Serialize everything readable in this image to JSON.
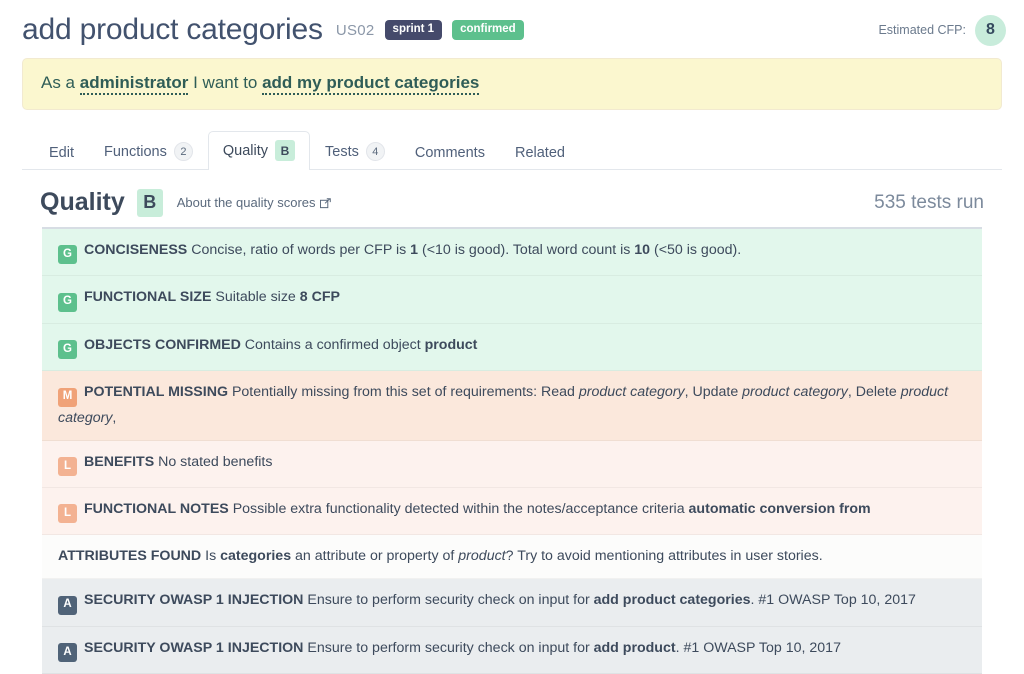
{
  "header": {
    "title": "add product categories",
    "story_ref": "US02",
    "sprint_chip": "sprint 1",
    "status_chip": "confirmed",
    "cfp_label": "Estimated CFP:",
    "cfp_value": "8",
    "colors": {
      "sprint_chip_bg": "#454a6b",
      "status_chip_bg": "#5dc08d",
      "cfp_circle_bg": "#c8ecdb"
    }
  },
  "story": {
    "prefix": "As a ",
    "role": "administrator",
    "middle": " I want to ",
    "goal": "add my product categories",
    "bg": "#fbf7cf"
  },
  "tabs": [
    {
      "label": "Edit",
      "count": null,
      "grade": null,
      "active": false
    },
    {
      "label": "Functions",
      "count": "2",
      "grade": null,
      "active": false
    },
    {
      "label": "Quality",
      "count": null,
      "grade": "B",
      "active": true
    },
    {
      "label": "Tests",
      "count": "4",
      "grade": null,
      "active": false
    },
    {
      "label": "Comments",
      "count": null,
      "grade": null,
      "active": false
    },
    {
      "label": "Related",
      "count": null,
      "grade": null,
      "active": false
    }
  ],
  "quality": {
    "heading": "Quality",
    "grade": "B",
    "about_link": "About the quality scores",
    "tests_run": "535 tests run"
  },
  "results": [
    {
      "badge": "G",
      "kind": "good",
      "title": "CONCISENESS",
      "segments": [
        {
          "t": " Concise, ratio of words per CFP is ",
          "s": "n"
        },
        {
          "t": "1",
          "s": "b"
        },
        {
          "t": " (<10 is good). Total word count is ",
          "s": "n"
        },
        {
          "t": "10",
          "s": "b"
        },
        {
          "t": " (<50 is good).",
          "s": "n"
        }
      ]
    },
    {
      "badge": "G",
      "kind": "good",
      "title": "FUNCTIONAL SIZE",
      "segments": [
        {
          "t": " Suitable size ",
          "s": "n"
        },
        {
          "t": "8 CFP",
          "s": "b"
        }
      ]
    },
    {
      "badge": "G",
      "kind": "good",
      "title": "OBJECTS CONFIRMED",
      "segments": [
        {
          "t": " Contains a confirmed object ",
          "s": "n"
        },
        {
          "t": "product",
          "s": "b"
        }
      ]
    },
    {
      "badge": "M",
      "kind": "missing",
      "title": "POTENTIAL MISSING",
      "segments": [
        {
          "t": " Potentially missing from this set of requirements: Read ",
          "s": "n"
        },
        {
          "t": "product category",
          "s": "i"
        },
        {
          "t": ", Update ",
          "s": "n"
        },
        {
          "t": "product category",
          "s": "i"
        },
        {
          "t": ", Delete ",
          "s": "n"
        },
        {
          "t": "product category",
          "s": "i"
        },
        {
          "t": ",",
          "s": "n"
        }
      ]
    },
    {
      "badge": "L",
      "kind": "low",
      "title": "BENEFITS",
      "segments": [
        {
          "t": " No stated benefits",
          "s": "n"
        }
      ]
    },
    {
      "badge": "L",
      "kind": "low",
      "title": "FUNCTIONAL NOTES",
      "segments": [
        {
          "t": " Possible extra functionality detected within the notes/acceptance criteria ",
          "s": "n"
        },
        {
          "t": "automatic conversion from",
          "s": "b"
        }
      ]
    },
    {
      "badge": null,
      "kind": "plain",
      "title": "ATTRIBUTES FOUND",
      "segments": [
        {
          "t": " Is ",
          "s": "n"
        },
        {
          "t": "categories",
          "s": "b"
        },
        {
          "t": " an attribute or property of ",
          "s": "n"
        },
        {
          "t": "product",
          "s": "i"
        },
        {
          "t": "? Try to avoid mentioning attributes in user stories.",
          "s": "n"
        }
      ]
    },
    {
      "badge": "A",
      "kind": "advisory",
      "title": "SECURITY OWASP 1 INJECTION",
      "segments": [
        {
          "t": " Ensure to perform security check on input for ",
          "s": "n"
        },
        {
          "t": "add product categories",
          "s": "b"
        },
        {
          "t": ". #1 OWASP Top 10, 2017",
          "s": "n"
        }
      ]
    },
    {
      "badge": "A",
      "kind": "advisory",
      "title": "SECURITY OWASP 1 INJECTION",
      "segments": [
        {
          "t": " Ensure to perform security check on input for ",
          "s": "n"
        },
        {
          "t": "add product",
          "s": "b"
        },
        {
          "t": ". #1 OWASP Top 10, 2017",
          "s": "n"
        }
      ]
    }
  ],
  "badge_colors": {
    "G": "#5dc08d",
    "M": "#f0a278",
    "L": "#f3b292",
    "A": "#506378"
  }
}
